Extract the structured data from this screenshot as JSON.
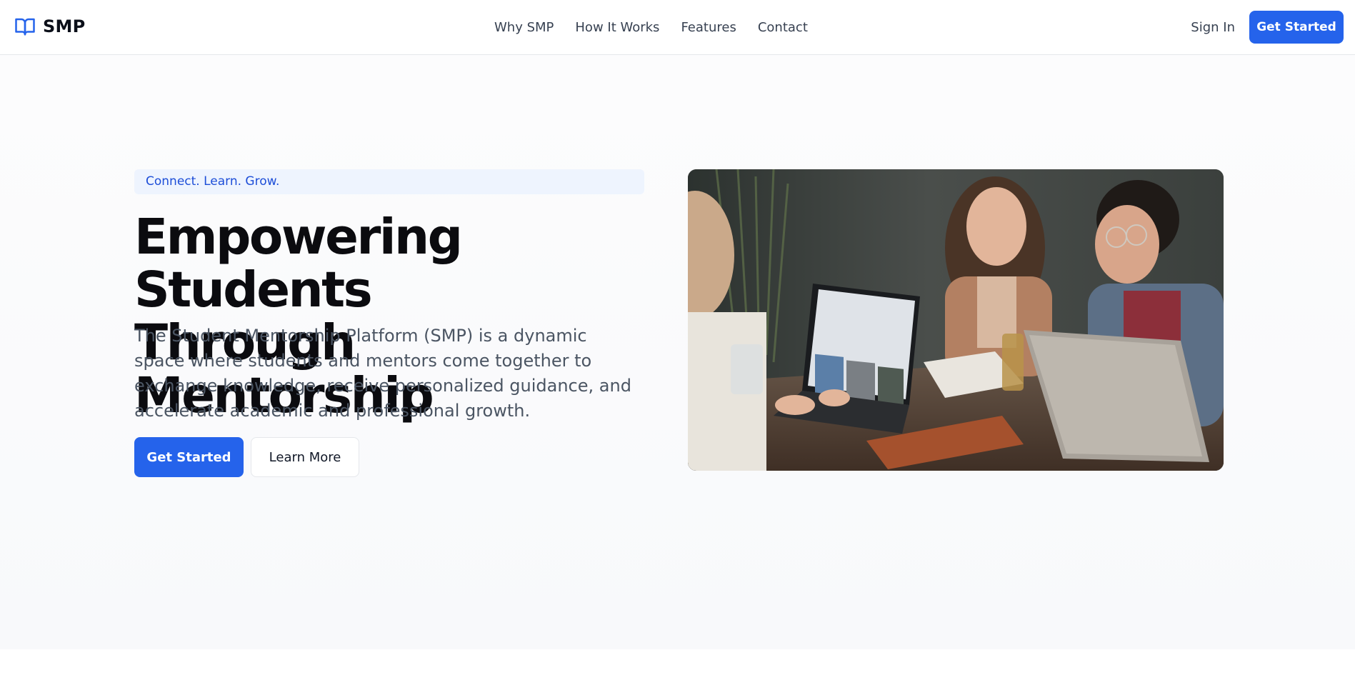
{
  "brand": {
    "name": "SMP",
    "icon": "book-open-icon"
  },
  "nav": {
    "items": [
      {
        "label": "Why SMP"
      },
      {
        "label": "How It Works"
      },
      {
        "label": "Features"
      },
      {
        "label": "Contact"
      }
    ]
  },
  "header": {
    "sign_in_label": "Sign In",
    "get_started_label": "Get Started"
  },
  "hero": {
    "tagline": "Connect. Learn. Grow.",
    "title_line1": "Empowering Students",
    "title_line2": "Through Mentorship",
    "description": "The Student Mentorship Platform (SMP) is a dynamic space where students and mentors come together to exchange knowledge, receive personalized guidance, and accelerate academic and professional growth.",
    "primary_cta": "Get Started",
    "secondary_cta": "Learn More",
    "image_alt": "students-collaborating-photo"
  },
  "colors": {
    "accent": "#2563eb",
    "tagline_bg": "#eef4fe",
    "tagline_text": "#1d4ed8",
    "heading": "#0b0b0f",
    "body_text": "#4b5563"
  }
}
